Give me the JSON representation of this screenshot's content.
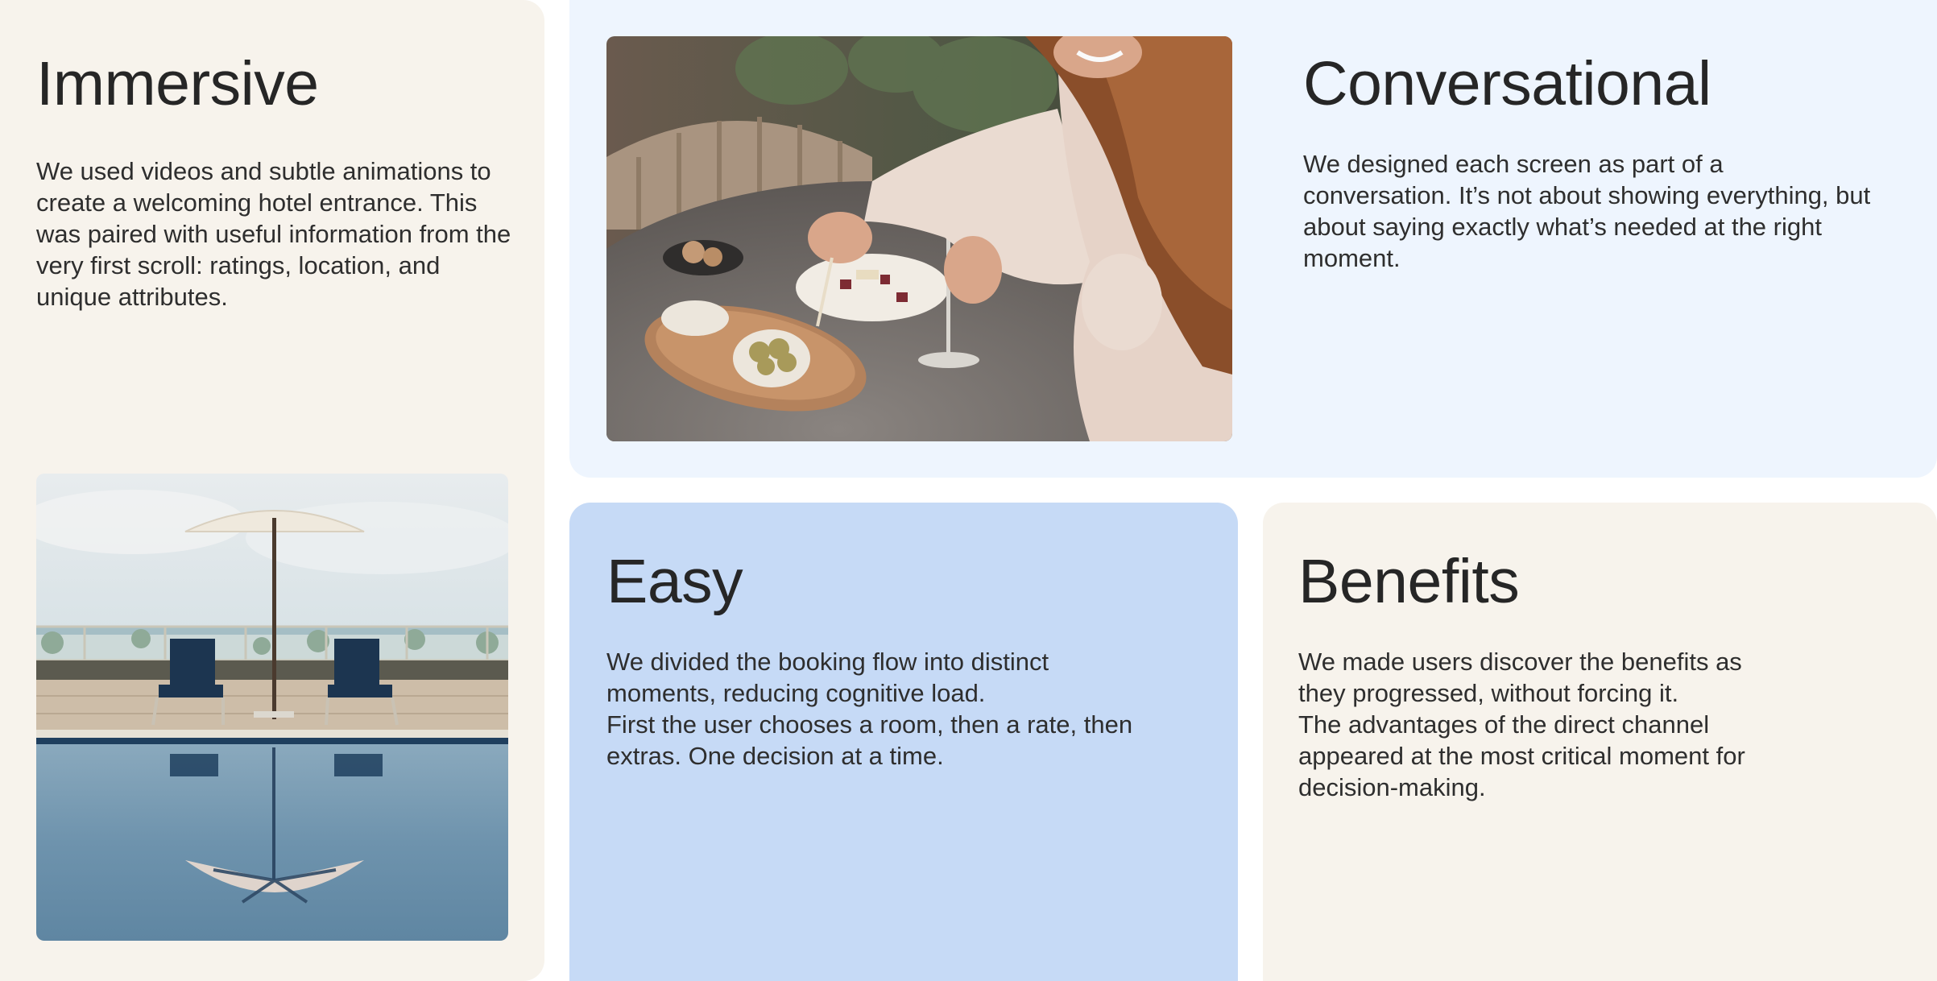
{
  "colors": {
    "beige_card": "#f7f3ec",
    "light_blue_card": "#eef5fe",
    "blue_card": "#c6daf6",
    "heading": "#262626",
    "text": "#2e2e2e"
  },
  "cards": {
    "immersive": {
      "title": "Immersive",
      "paragraphs": [
        "We used videos and subtle animations to create a welcoming hotel entrance. This was paired with useful information from the very first scroll: ratings, location, and unique attributes."
      ],
      "image": "pool-with-umbrella-photo"
    },
    "conversational": {
      "title": "Conversational",
      "paragraphs": [
        "We designed each screen as part of a conversation. It’s not about showing everything, but about saying exactly what’s needed at the right moment."
      ],
      "image": "woman-dining-photo"
    },
    "easy": {
      "title": "Easy",
      "paragraphs": [
        "We divided the booking flow into distinct moments, reducing cognitive load.",
        "First the user chooses a room, then a rate, then extras. One decision at a time."
      ]
    },
    "benefits": {
      "title": "Benefits",
      "paragraphs": [
        "We made users discover the benefits as they progressed, without forcing it.",
        "The advantages of the direct channel appeared at the most critical moment for decision-making."
      ]
    }
  }
}
